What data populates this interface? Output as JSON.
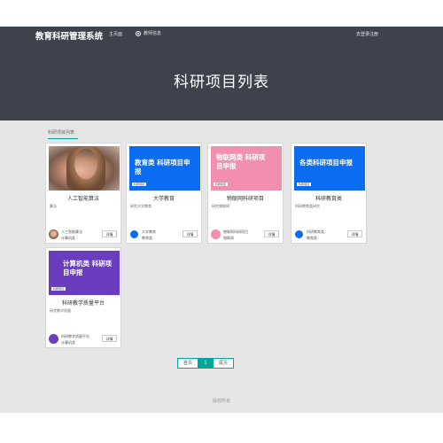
{
  "nav": {
    "brand": "教育科研管理系统",
    "home": "主页面",
    "info": "教师信息",
    "login": "去登录注册"
  },
  "page": {
    "title": "科研项目列表"
  },
  "breadcrumb": "科研项目列表",
  "cards": [
    {
      "image_type": "photo",
      "title": "人工智能算法",
      "subtitle": "算法",
      "author": "人工智能算法",
      "category": "计算机类",
      "button": "详情"
    },
    {
      "image_type": "banner",
      "banner_text": "教育类 科研项目申报",
      "banner_color": "#0a6cf0",
      "banner_tag": "科研项目",
      "title": "大学教育",
      "subtitle": "研究大学教育",
      "author": "大学教育",
      "category": "教育类",
      "button": "详情"
    },
    {
      "image_type": "banner",
      "banner_text": "物联网类 科研项目申报",
      "banner_color": "#f28fae",
      "banner_tag": "科研项目",
      "title": "物联网科研项目",
      "subtitle": "研究物联网",
      "author": "物联网科研项目",
      "category": "物联网",
      "button": "详情"
    },
    {
      "image_type": "banner",
      "banner_text": "各类科研项目申报",
      "banner_color": "#0a6cf0",
      "banner_tag": "科研项目",
      "title": "科研教育类",
      "subtitle": "科研教育类研究",
      "author": "科研教育类",
      "category": "教育类",
      "button": "详情"
    },
    {
      "image_type": "banner",
      "banner_text": "计算机类 科研项目申报",
      "banner_color": "#6a3dbf",
      "banner_tag": "科研项目",
      "title": "科研教学质量平台",
      "subtitle": "研究教学质量",
      "author": "科研教学质量平台",
      "category": "计算机类",
      "button": "详情"
    }
  ],
  "pagination": {
    "first": "首页",
    "current": "1",
    "last": "尾页"
  },
  "footer": "版权所有",
  "colors": {
    "header_bg": "#3d424c",
    "accent": "#00a59c",
    "content_bg": "#e6e6e6"
  }
}
